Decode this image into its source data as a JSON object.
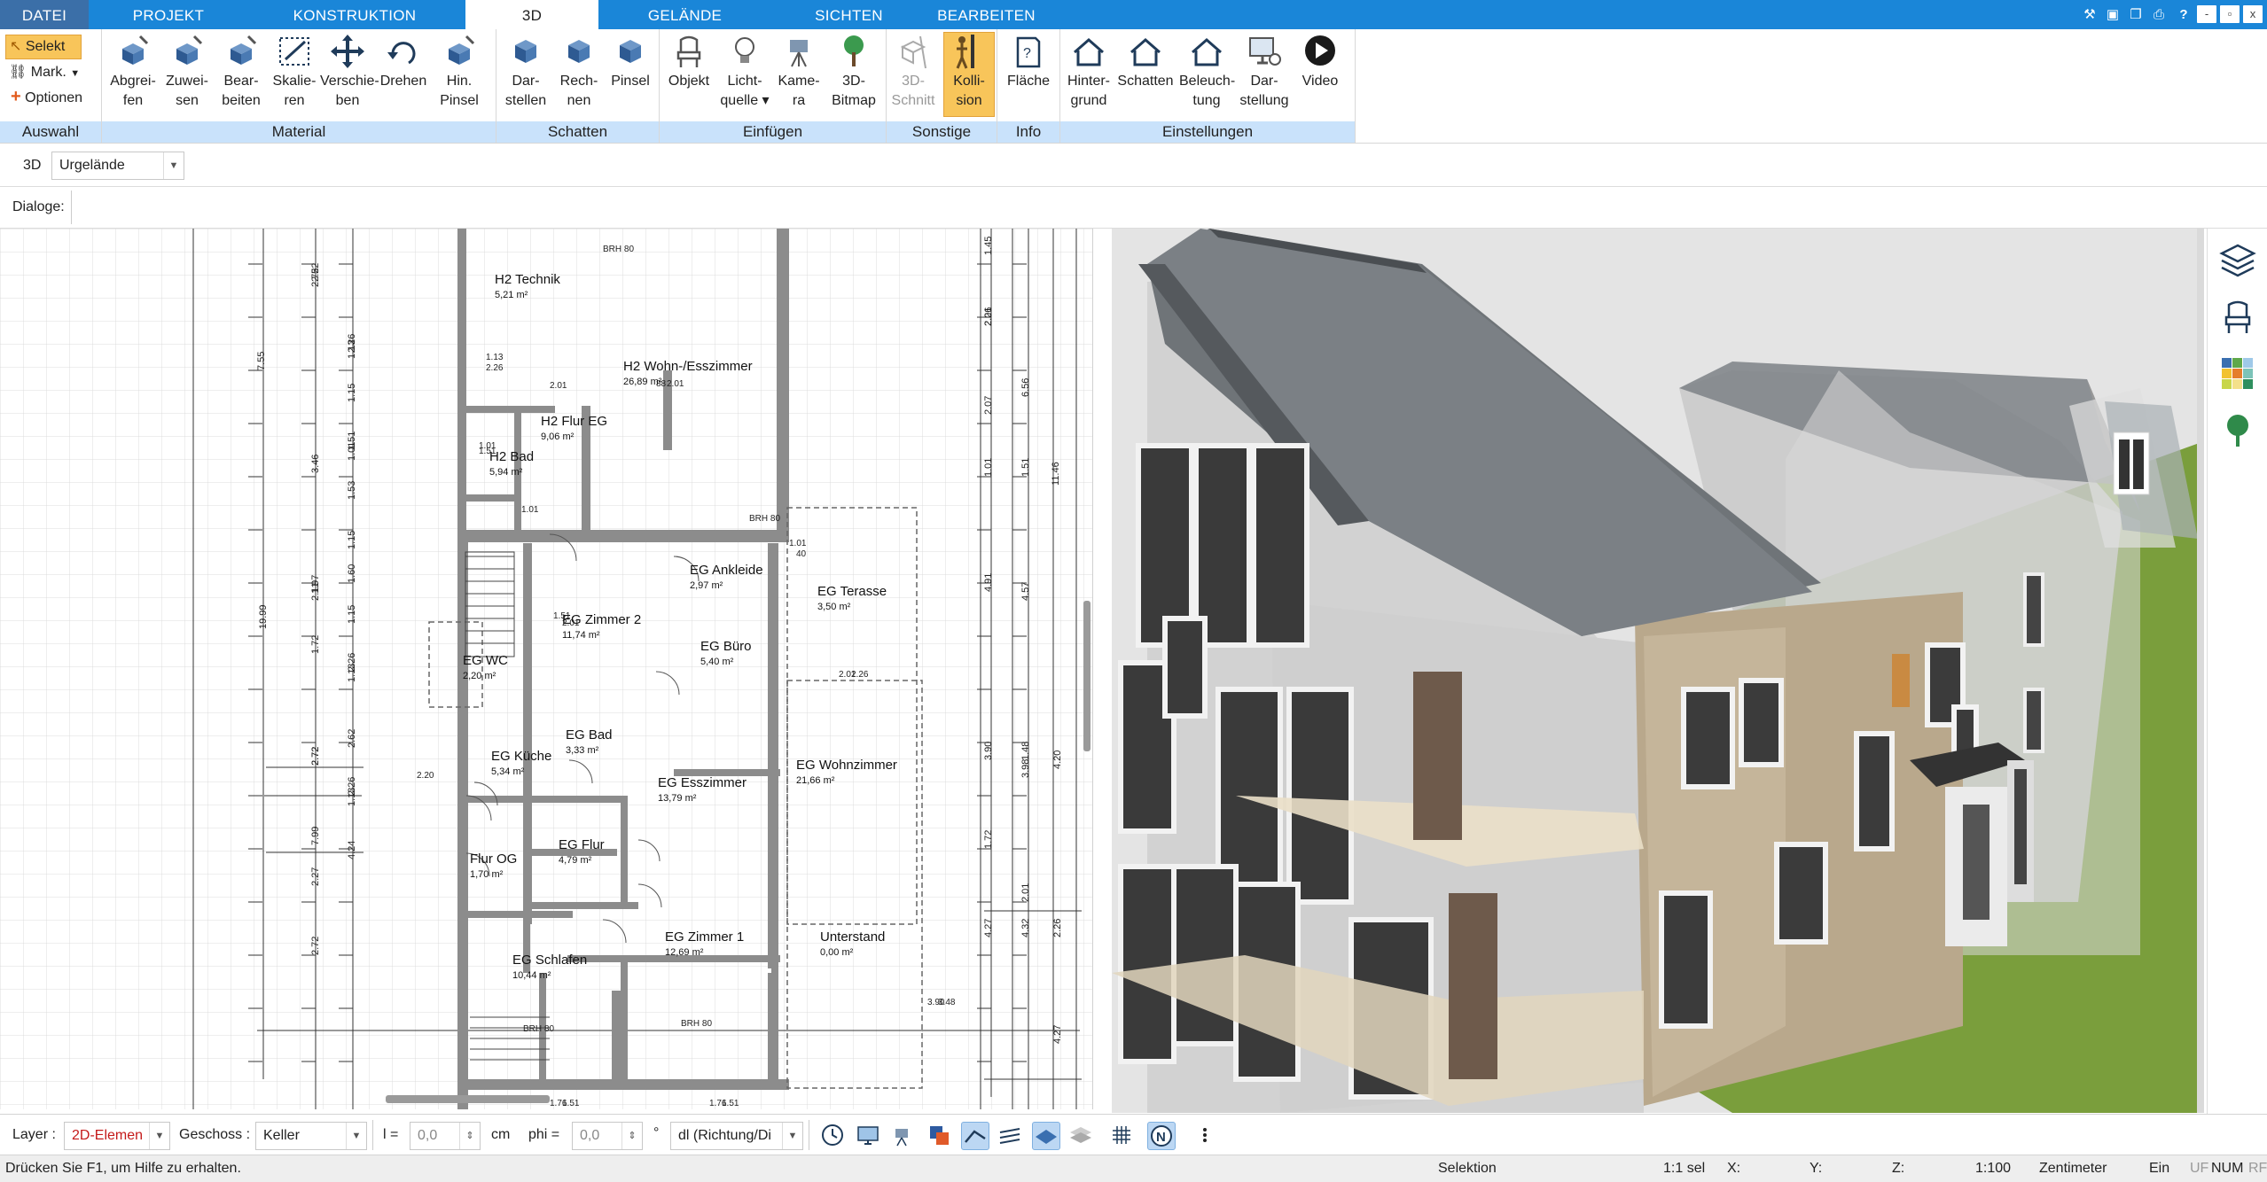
{
  "tabs": [
    "DATEI",
    "PROJEKT",
    "KONSTRUKTION",
    "3D",
    "GELÄNDE",
    "SICHTEN",
    "BEARBEITEN"
  ],
  "active_tab": "3D",
  "window_buttons": {
    "minimize": "-",
    "maximize": "▫",
    "close": "x"
  },
  "ribbon": {
    "auswahl": {
      "label": "Auswahl",
      "selekt": "Selekt",
      "mark": "Mark.",
      "optionen": "Optionen"
    },
    "material": {
      "label": "Material",
      "buttons": [
        [
          "Abgrei-",
          "fen"
        ],
        [
          "Zuwei-",
          "sen"
        ],
        [
          "Bear-",
          "beiten"
        ],
        [
          "Skalie-",
          "ren"
        ],
        [
          "Verschie-",
          "ben"
        ],
        [
          "Drehen",
          ""
        ],
        [
          "Hin.",
          "Pinsel"
        ]
      ]
    },
    "schatten": {
      "label": "Schatten",
      "buttons": [
        [
          "Dar-",
          "stellen"
        ],
        [
          "Rech-",
          "nen"
        ],
        [
          "Pinsel",
          ""
        ]
      ]
    },
    "einfuegen": {
      "label": "Einfügen",
      "buttons": [
        [
          "Objekt",
          ""
        ],
        [
          "Licht-",
          "quelle ▾"
        ],
        [
          "Kame-",
          "ra"
        ],
        [
          "3D-",
          "Bitmap"
        ]
      ]
    },
    "sonstige": {
      "label": "Sonstige",
      "buttons": [
        [
          "3D-",
          "Schnitt"
        ],
        [
          "Kolli-",
          "sion"
        ]
      ]
    },
    "info": {
      "label": "Info",
      "buttons": [
        [
          "Fläche",
          ""
        ]
      ]
    },
    "einstellungen": {
      "label": "Einstellungen",
      "buttons": [
        [
          "Hinter-",
          "grund"
        ],
        [
          "Schatten",
          ""
        ],
        [
          "Beleuch-",
          "tung"
        ],
        [
          "Dar-",
          "stellung"
        ],
        [
          "Video",
          ""
        ]
      ]
    }
  },
  "toolbar": {
    "mode_label": "3D",
    "terrain_value": "Urgelände",
    "dialoge_label": "Dialoge:"
  },
  "plan": {
    "rooms": [
      {
        "name": "H2 Technik",
        "area": "5,21 m²"
      },
      {
        "name": "H2 Wohn-/Esszimmer",
        "area": "26,89 m²"
      },
      {
        "name": "H2 Flur EG",
        "area": "9,06 m²"
      },
      {
        "name": "H2 Bad",
        "area": "5,94 m²"
      },
      {
        "name": "EG Ankleide",
        "area": "2,97 m²"
      },
      {
        "name": "EG Terasse",
        "area": "3,50 m²"
      },
      {
        "name": "EG Zimmer 2",
        "area": "11,74 m²"
      },
      {
        "name": "EG Büro",
        "area": "5,40 m²"
      },
      {
        "name": "EG WC",
        "area": "2,20 m²"
      },
      {
        "name": "EG Küche",
        "area": "5,34 m²"
      },
      {
        "name": "EG Bad",
        "area": "3,33 m²"
      },
      {
        "name": "EG Esszimmer",
        "area": "13,79 m²"
      },
      {
        "name": "EG Wohnzimmer",
        "area": "21,66 m²"
      },
      {
        "name": "EG Flur",
        "area": "4,79 m²"
      },
      {
        "name": "Flur OG",
        "area": "1,70 m²"
      },
      {
        "name": "Unterstand",
        "area": "0,00 m²"
      },
      {
        "name": "EG Zimmer 1",
        "area": "12,69 m²"
      },
      {
        "name": "EG Schlafen",
        "area": "10,44 m²"
      }
    ],
    "dims_left": [
      "2.52",
      "2.72",
      "1.13",
      "2.26",
      "1.15",
      "1.01",
      "1.51",
      "1.53",
      "1.15",
      "1.60",
      "1.15",
      "1.13",
      "2.26",
      "2.62",
      "1.13",
      "2.26",
      "2.72",
      "4.24",
      "7.55",
      "3.46",
      "1.97",
      "1.72",
      "7.99",
      "19.99",
      "2.11",
      "2.72",
      "2.27",
      "2.72"
    ],
    "dims_right": [
      "1.45",
      "2.01",
      "2.26",
      "2.07",
      "1.01",
      "1.51",
      "4.91",
      "4.57",
      "1.48",
      "3.90",
      "3.98",
      "4.20",
      "6.56",
      "11.46",
      "4.32",
      "4.27",
      "2.01",
      "2.26",
      "1.72",
      "4.27"
    ],
    "labels_small": [
      "BRH 80",
      "BRH 80",
      "BRH 80",
      "BRH 80",
      "1.01",
      "1.51",
      "1.13",
      "2.26",
      "2.01",
      "88",
      "2.01",
      "1.01",
      "1.51",
      "2.01",
      "2.20",
      "1.01",
      "40",
      "2.01",
      "2.26",
      "3.90",
      "3.48",
      "1.76",
      "1.51",
      "1.76",
      "1.51"
    ]
  },
  "sidebar_icons": [
    "layers-icon",
    "chair-icon",
    "palette-icon",
    "tree-icon"
  ],
  "bottombar": {
    "layer_label": "Layer :",
    "layer_value": "2D-Elemen",
    "geschoss_label": "Geschoss :",
    "geschoss_value": "Keller",
    "l_label": "l =",
    "l_value": "0,0",
    "l_unit": "cm",
    "phi_label": "phi =",
    "phi_value": "0,0",
    "phi_unit": "°",
    "mode_value": "dl (Richtung/Di"
  },
  "status": {
    "help": "Drücken Sie F1, um Hilfe zu erhalten.",
    "mode": "Selektion",
    "sel": "1:1 sel",
    "x": "X:",
    "y": "Y:",
    "z": "Z:",
    "scale": "1:100",
    "unit": "Zentimeter",
    "ein": "Ein",
    "uf": "UF",
    "num": "NUM",
    "rf": "RF"
  },
  "colors": {
    "tab_bar": "#1a86d8",
    "group_label": "#c9e2fb",
    "active_button": "#f8c55a",
    "lawn": "#7a9e3c",
    "roof": "#6f7478",
    "sky": "#e4e4e4"
  }
}
